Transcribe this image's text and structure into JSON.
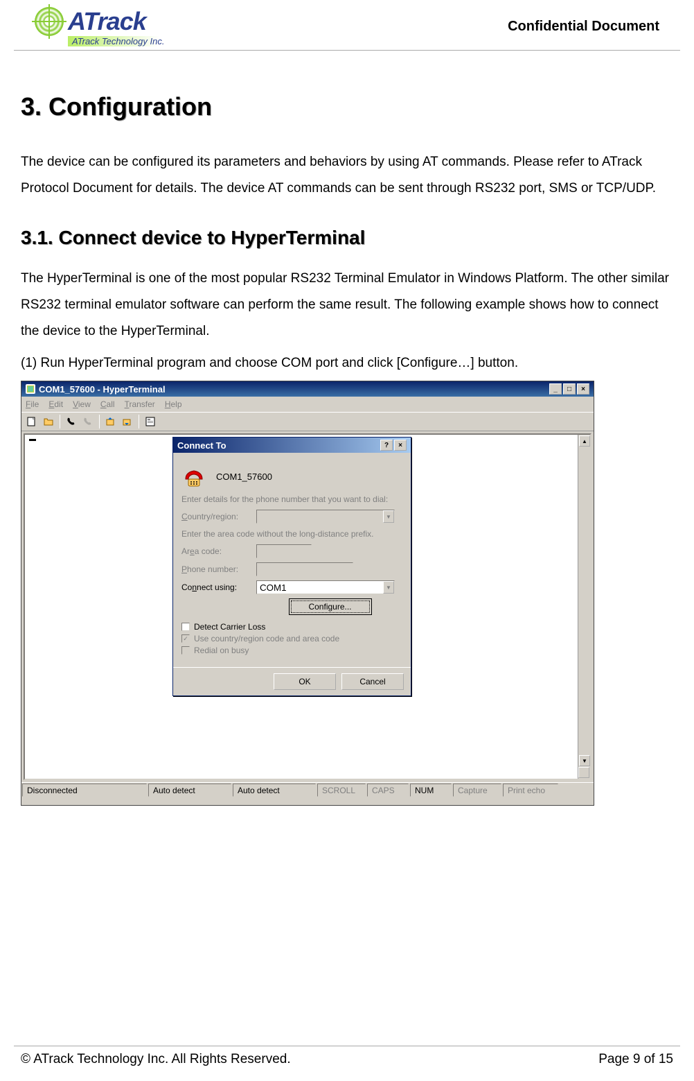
{
  "header": {
    "logo_main": "ATrack",
    "logo_sub": "ATrack Technology Inc.",
    "right": "Confidential Document"
  },
  "content": {
    "h1": "3. Configuration",
    "intro": "The device can be configured its parameters and behaviors by using AT commands. Please refer to ATrack Protocol Document for details. The device AT commands can be sent through RS232 port, SMS or TCP/UDP.",
    "h2": "3.1.  Connect device to HyperTerminal",
    "para2": "The HyperTerminal is one of the most popular RS232 Terminal Emulator in Windows Platform. The other similar RS232 terminal emulator software can perform the same result. The following example shows how to connect the device to the HyperTerminal.",
    "step1": "(1)  Run HyperTerminal program and choose COM port and click [Configure…] button."
  },
  "screenshot": {
    "window_title": "COM1_57600 - HyperTerminal",
    "menus": {
      "file": "File",
      "edit": "Edit",
      "view": "View",
      "call": "Call",
      "transfer": "Transfer",
      "help": "Help"
    },
    "status": {
      "conn": "Disconnected",
      "auto1": "Auto detect",
      "auto2": "Auto detect",
      "scroll": "SCROLL",
      "caps": "CAPS",
      "num": "NUM",
      "capture": "Capture",
      "print": "Print echo"
    },
    "dialog": {
      "title": "Connect To",
      "conn_name": "COM1_57600",
      "msg1": "Enter details for the phone number that you want to dial:",
      "country_label": "Country/region:",
      "msg2": "Enter the area code without the long-distance prefix.",
      "area_label": "Area code:",
      "phone_label": "Phone number:",
      "connect_label": "Connect using:",
      "connect_value": "COM1",
      "configure_btn": "Configure...",
      "chk_detect": "Detect Carrier Loss",
      "chk_country": "Use country/region code and area code",
      "chk_redial": "Redial on busy",
      "ok": "OK",
      "cancel": "Cancel"
    }
  },
  "footer": {
    "left": "© ATrack Technology Inc. All Rights Reserved.",
    "right": "Page 9 of 15"
  }
}
